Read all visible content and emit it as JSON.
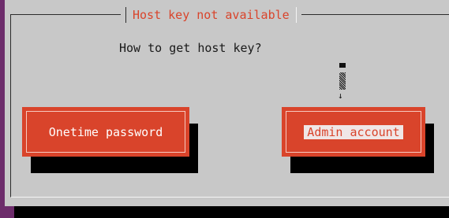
{
  "dialog": {
    "title": "Host key not available",
    "question": "How to get host key?"
  },
  "scrollbar": {
    "down_arrow": "↓"
  },
  "buttons": {
    "onetime": "Onetime password",
    "admin": "Admin account"
  },
  "colors": {
    "background": "#6d2c6b",
    "dialog": "#c8c8c8",
    "accent": "#d9442b"
  }
}
